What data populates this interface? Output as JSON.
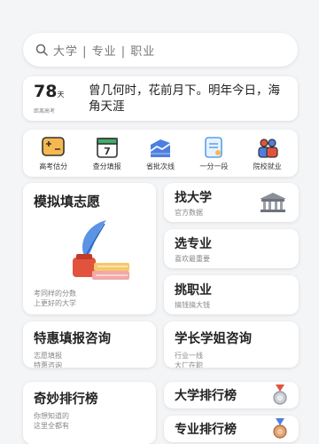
{
  "search": {
    "placeholder": "大学 | 专业 | 职业"
  },
  "countdown": {
    "days": "78",
    "unit": "天",
    "label": "距离高考",
    "quote": "曾几何时，花前月下。明年今日，海角天涯"
  },
  "tools": [
    {
      "label": "高考估分",
      "icon": "score-estimate-icon"
    },
    {
      "label": "查分填报",
      "icon": "calendar-7-icon"
    },
    {
      "label": "省批次线",
      "icon": "chart-line-icon"
    },
    {
      "label": "一分一段",
      "icon": "document-icon"
    },
    {
      "label": "院校就业",
      "icon": "people-icon"
    }
  ],
  "cards": {
    "moni": {
      "title": "模拟填志愿",
      "sub1": "考同样的分数",
      "sub2": "上更好的大学"
    },
    "findu": {
      "title": "找大学",
      "sub": "官方数据"
    },
    "major": {
      "title": "选专业",
      "sub": "喜欢最重要"
    },
    "career": {
      "title": "挑职业",
      "sub": "搞钱搞大钱"
    },
    "tehui": {
      "title": "特惠填报咨询",
      "sub1": "志愿填报",
      "sub2": "特惠咨询"
    },
    "xuezhang": {
      "title": "学长学姐咨询",
      "sub1": "行业一线",
      "sub2": "大厂在职"
    },
    "qimiao": {
      "title": "奇妙排行榜",
      "sub1": "你想知道的",
      "sub2": "这里全都有"
    },
    "uni_rank": {
      "title": "大学排行榜"
    },
    "maj_rank": {
      "title": "专业排行榜"
    }
  },
  "colors": {
    "accent_orange": "#f0a444",
    "accent_blue": "#3d6fd6",
    "accent_red": "#e2533d"
  }
}
